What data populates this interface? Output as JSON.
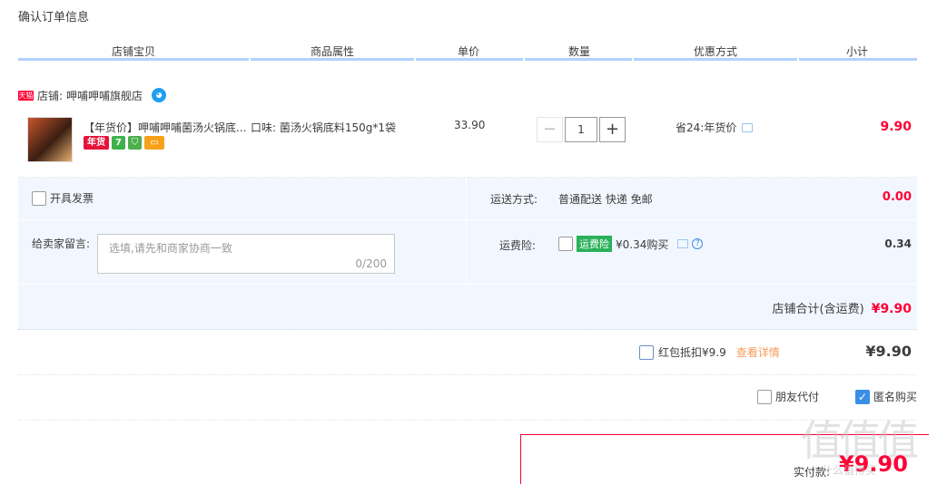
{
  "page_title": "确认订单信息",
  "columns": [
    "店铺宝贝",
    "商品属性",
    "单价",
    "数量",
    "优惠方式",
    "小计"
  ],
  "shop": {
    "badge": "天猫",
    "label": "店铺:",
    "name": "呷哺呷哺旗舰店"
  },
  "item": {
    "title": "【年货价】呷哺呷哺菌汤火锅底...",
    "badges": [
      "年货",
      "7",
      "",
      ""
    ],
    "attribute": "口味: 菌汤火锅底料150g*1袋",
    "price": "33.90",
    "quantity": "1",
    "qty_minus": "−",
    "qty_plus": "+",
    "discount": "省24:年货价",
    "subtotal": "9.90"
  },
  "options": {
    "invoice_label": "开具发票",
    "message_label": "给卖家留言:",
    "message_placeholder": "选填,请先和商家协商一致",
    "message_count": "0/200",
    "shipping_label": "运送方式:",
    "shipping_value": "普通配送 快递 免邮",
    "shipping_price": "0.00",
    "insurance_label": "运费险:",
    "insurance_tag": "运费险",
    "insurance_text": "¥0.34购买",
    "insurance_price": "0.34",
    "shop_total_label": "店铺合计(含运费)",
    "shop_total_value": "¥9.90"
  },
  "redpack": {
    "label": "红包抵扣¥9.9",
    "link": "查看详情",
    "total": "¥9.90"
  },
  "pay": {
    "friend_label": "朋友代付",
    "anonymous_label": "匿名购买",
    "anonymous_checked": true
  },
  "final": {
    "label": "实付款:",
    "value": "¥9.90"
  },
  "watermark": {
    "text": "值值值",
    "sub": "什么值得买"
  },
  "colors": {
    "accent_red": "#ff0036",
    "header_line": "#b2d1ff",
    "panel_bg": "#f2f7ff",
    "checkbox_blue": "#3a8ee6"
  }
}
